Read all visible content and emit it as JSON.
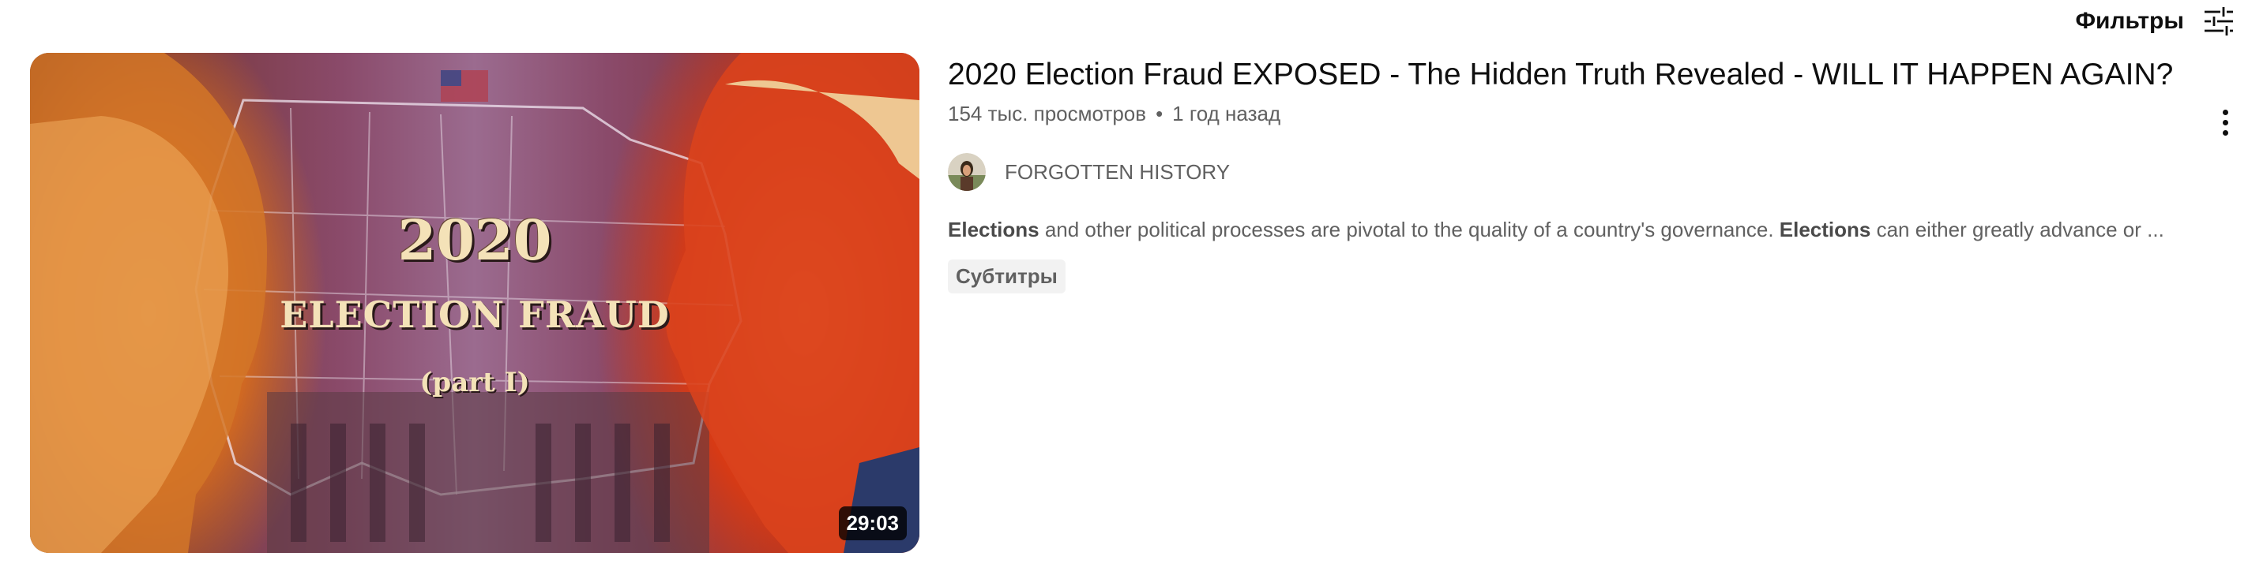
{
  "filters": {
    "label": "Фильтры",
    "icon": "filter-sliders-icon"
  },
  "video": {
    "title": "2020 Election Fraud EXPOSED - The Hidden Truth Revealed - WILL IT HAPPEN AGAIN?",
    "views": "154 тыс. просмотров",
    "separator": "•",
    "age": "1 год назад",
    "duration": "29:03",
    "channel": {
      "name": "FORGOTTEN HISTORY",
      "avatar_icon": "channel-avatar"
    },
    "description": {
      "part1_bold": "Elections",
      "part2": " and other political processes are pivotal to the quality of a country's governance. ",
      "part3_bold": "Elections",
      "part4": " can either greatly advance or ..."
    },
    "badge": "Субтитры",
    "thumbnail": {
      "year": "2020",
      "headline": "ELECTION FRAUD",
      "subline": "(part I)"
    },
    "menu_icon": "more-vert-icon"
  }
}
